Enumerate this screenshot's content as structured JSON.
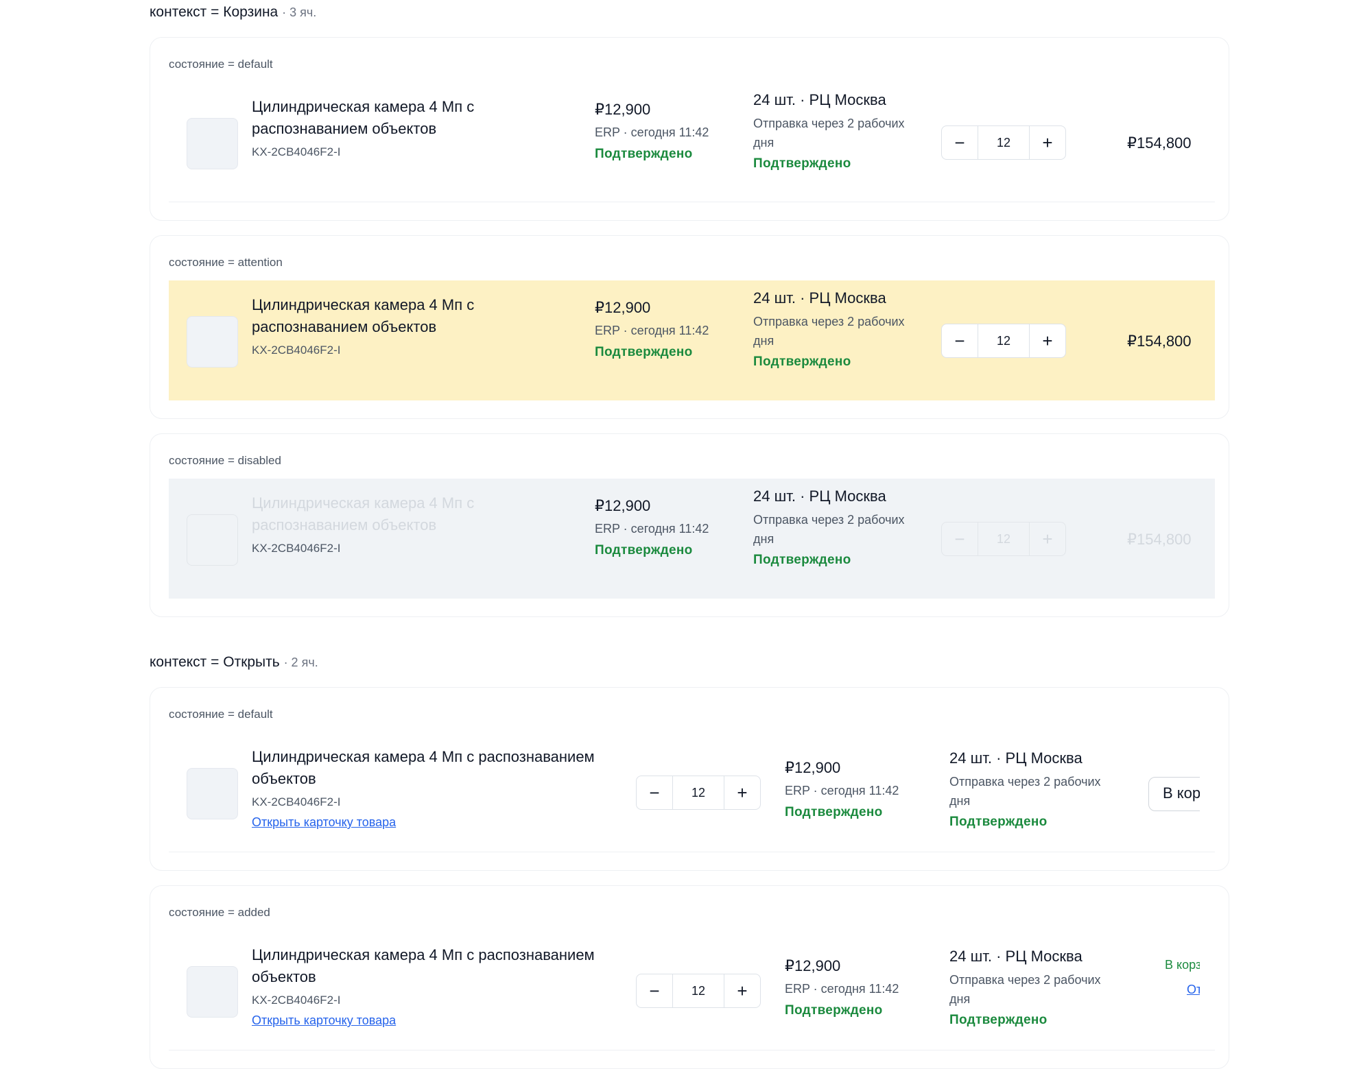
{
  "product": {
    "name_line1_narrow": "Цилиндрическая камера 4 Мп с",
    "name_line2_narrow": "распознаванием объектов",
    "name_line1_wide": "Цилиндрическая камера 4 Мп с распознаванием",
    "name_line2_wide": "объектов",
    "sku": "KX-2CB4046F2-I",
    "open_card_link": "Открыть карточку товара"
  },
  "pricing": {
    "price": "₽12,900",
    "source": "ERP · сегодня 11:42",
    "status": "Подтверждено"
  },
  "stock": {
    "amount": "24 шт. · РЦ Москва",
    "shipping": "Отправка через 2 рабочих дня",
    "status": "Подтверждено"
  },
  "stepper": {
    "minus": "−",
    "value": "12",
    "plus": "+"
  },
  "total": "₽154,800",
  "contexts": {
    "cart": {
      "title": "контекст = Корзина",
      "count": "· 3 яч."
    },
    "open": {
      "title": "контекст = Открыть",
      "count": "· 2 яч."
    }
  },
  "states": {
    "default": "состояние = default",
    "attention": "состояние = attention",
    "disabled": "состояние = disabled",
    "added": "состояние = added"
  },
  "actions": {
    "add_to_cart": "В корзину",
    "in_cart": "В корзине",
    "open": "Открыть"
  },
  "colors": {
    "attention_bg": "#fdf1c4",
    "disabled_bg": "#f0f3f6",
    "confirmed_green": "#1b8a3e",
    "link_blue": "#2563eb"
  }
}
